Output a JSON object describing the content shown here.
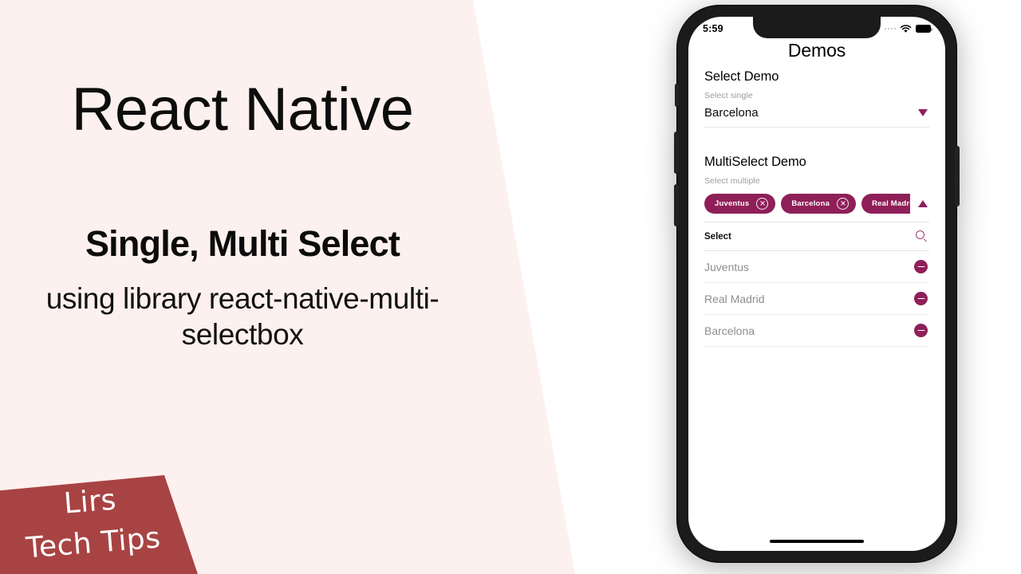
{
  "slide": {
    "title": "React Native",
    "subtitle_bold": "Single, Multi Select",
    "subtitle_light": "using library react-native-multi-selectbox",
    "bg_pink": "#fdf1ef",
    "bg_white": "#ffffff"
  },
  "logo": {
    "line1": "Lirs",
    "line2": "Tech Tips",
    "color": "#a84343"
  },
  "phone": {
    "status": {
      "time": "5:59",
      "signal_icon": "signal-dots-icon",
      "wifi_icon": "wifi-icon",
      "battery_icon": "battery-icon"
    },
    "nav_title": "Demos",
    "home_indicator": "home-indicator"
  },
  "app": {
    "accent": "#8f1f58",
    "single_select": {
      "heading": "Select Demo",
      "label": "Select single",
      "value": "Barcelona",
      "caret_icon": "chevron-down-icon"
    },
    "multi_select": {
      "heading": "MultiSelect Demo",
      "label": "Select multiple",
      "chips": [
        {
          "label": "Juventus",
          "remove_icon": "close-circle-icon"
        },
        {
          "label": "Barcelona",
          "remove_icon": "close-circle-icon"
        },
        {
          "label": "Real Madrid",
          "remove_icon": "close-circle-icon"
        }
      ],
      "toggle_icon": "chevron-up-icon",
      "search_placeholder": "Select",
      "search_icon": "search-icon",
      "options": [
        {
          "label": "Juventus",
          "action_icon": "minus-circle-icon"
        },
        {
          "label": "Real Madrid",
          "action_icon": "minus-circle-icon"
        },
        {
          "label": "Barcelona",
          "action_icon": "minus-circle-icon"
        }
      ]
    }
  }
}
